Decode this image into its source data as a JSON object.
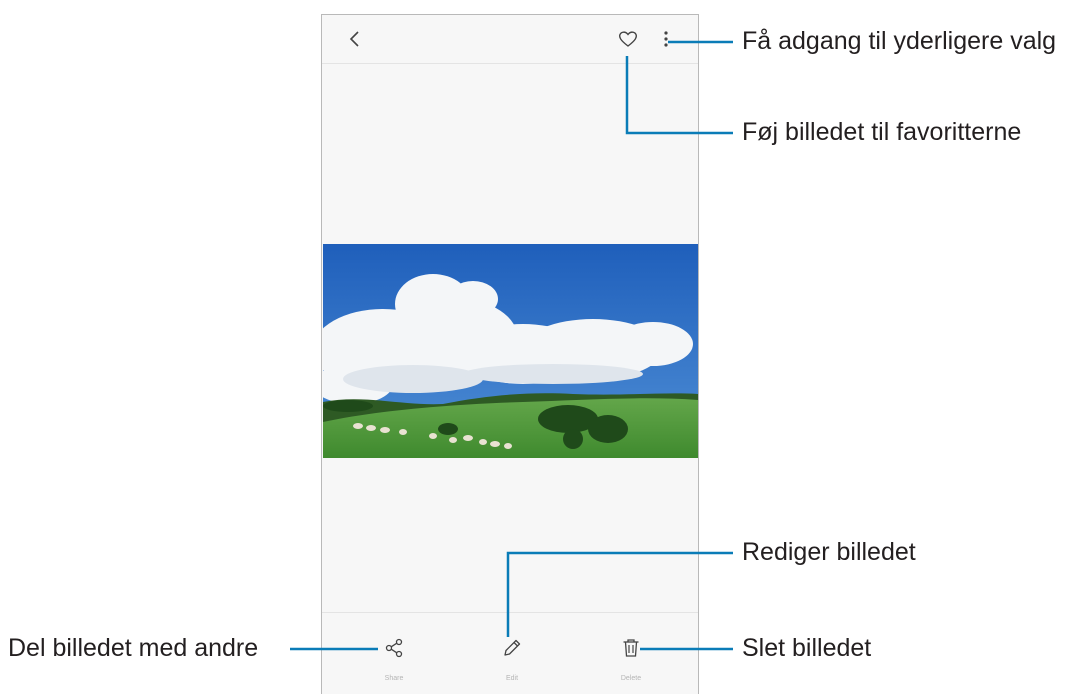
{
  "toolbar": {
    "back_icon": "chevron-left-icon",
    "favorite_icon": "heart-outline-icon",
    "more_icon": "more-vertical-icon"
  },
  "bottom_bar": {
    "share_label": "Share",
    "edit_label": "Edit",
    "delete_label": "Delete",
    "share_icon": "share-icon",
    "edit_icon": "pencil-icon",
    "delete_icon": "trash-icon"
  },
  "callouts": {
    "more_options": "Få adgang til yderligere valg",
    "add_favorite": "Føj billedet til favoritterne",
    "edit_picture": "Rediger billedet",
    "share_picture": "Del billedet med andre",
    "delete_picture": "Slet billedet"
  },
  "colors": {
    "leader_line": "#0a7cb7",
    "sky": "#2f6fc4",
    "grass": "#4f9a3a"
  }
}
